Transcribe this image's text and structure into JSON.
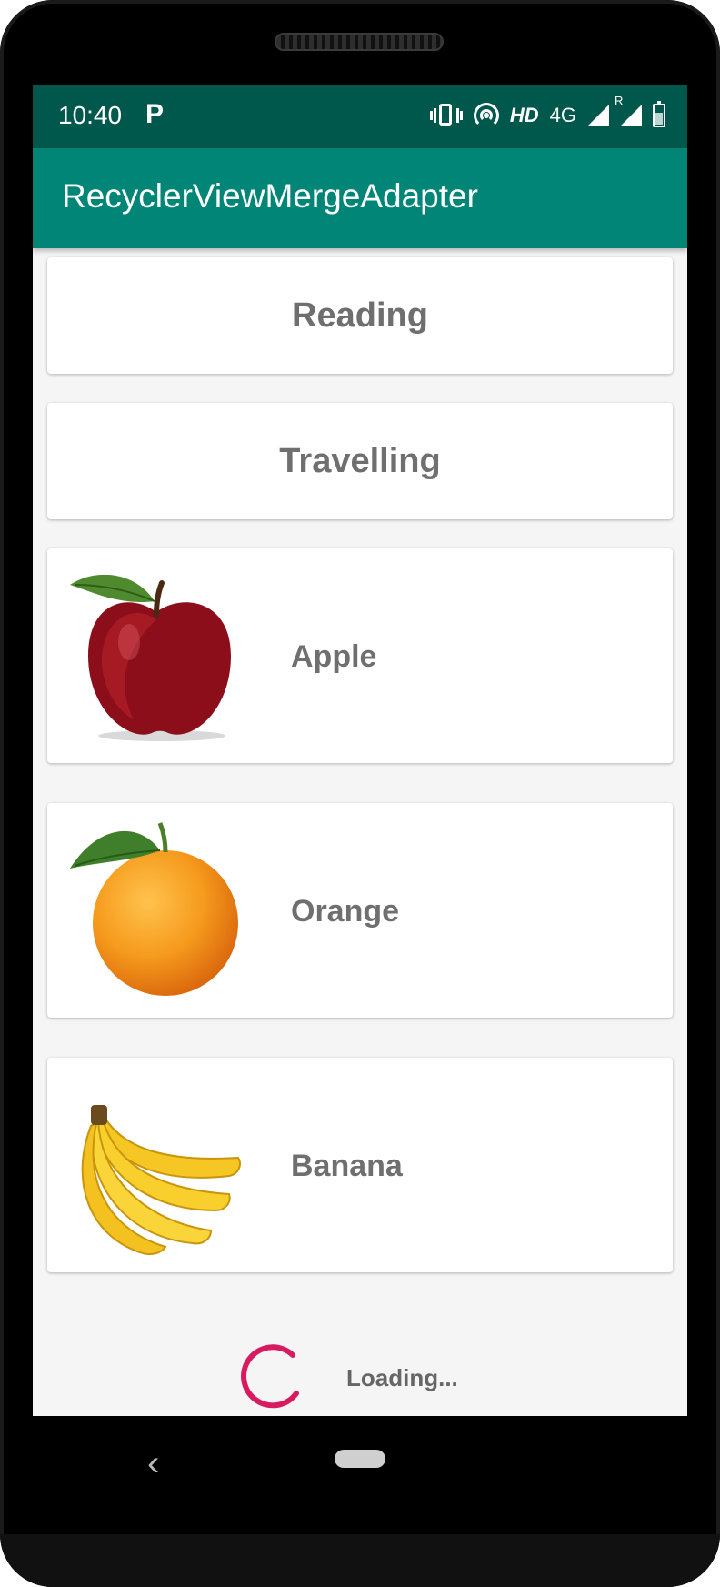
{
  "status_bar": {
    "time": "10:40",
    "notification_icon": "parking-p-icon",
    "hd_label": "HD",
    "network_label": "4G",
    "roaming_label": "R"
  },
  "app_bar": {
    "title": "RecyclerViewMergeAdapter"
  },
  "header_items": [
    {
      "label": "Reading"
    },
    {
      "label": "Travelling"
    }
  ],
  "fruit_items": [
    {
      "label": "Apple",
      "icon": "apple-image"
    },
    {
      "label": "Orange",
      "icon": "orange-image"
    },
    {
      "label": "Banana",
      "icon": "banana-image"
    }
  ],
  "footer": {
    "loading_text": "Loading..."
  },
  "colors": {
    "status_bar": "#00574b",
    "app_bar": "#008577",
    "spinner": "#d81b60",
    "label_text": "#6f6f6f"
  }
}
